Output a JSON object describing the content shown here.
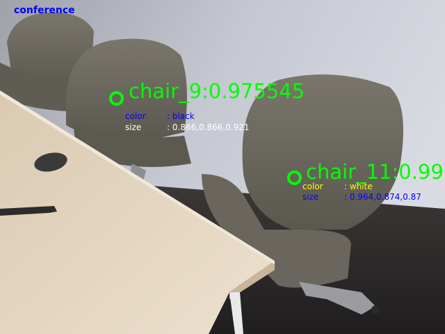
{
  "scene": {
    "label": "conference",
    "label_color": "#0000ff"
  },
  "detections": [
    {
      "title": "chair_9:0.975545",
      "color_key": "color",
      "color_value": ": black",
      "color_text_color": "#0000ff",
      "size_key": "size",
      "size_value": ": 0.866,0.866,0.921",
      "size_text_color": "#ffffff"
    },
    {
      "title": "chair_11:0.99",
      "color_key": "color",
      "color_value": ": white",
      "color_text_color": "#ffff00",
      "size_key": "size",
      "size_value": ": 0.964,0.874,0.87",
      "size_text_color": "#0000ff"
    }
  ],
  "colors": {
    "detection_green": "#00ff00",
    "wall": "#c9ccd6",
    "floor": "#2c2a2b",
    "table_top": "#e4d5bf",
    "chair_fabric": "#6b675e"
  }
}
